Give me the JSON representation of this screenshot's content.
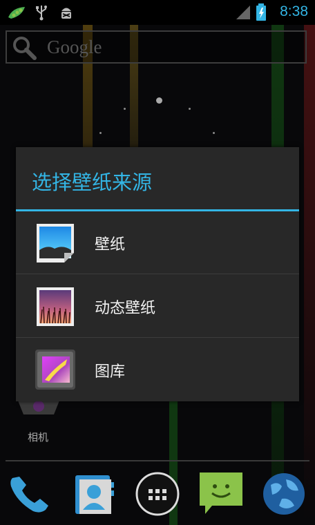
{
  "status_bar": {
    "time": "8:38",
    "icons": [
      "pea-pod-icon",
      "usb-icon",
      "android-debug-icon",
      "signal-icon",
      "battery-charging-icon"
    ]
  },
  "search_bar": {
    "text": "Google",
    "icon": "search-icon"
  },
  "dialog": {
    "title": "选择壁纸来源",
    "items": [
      {
        "label": "壁纸",
        "icon": "wallpaper-icon"
      },
      {
        "label": "动态壁纸",
        "icon": "live-wallpaper-icon"
      },
      {
        "label": "图库",
        "icon": "gallery-icon"
      }
    ]
  },
  "home": {
    "camera_label": "相机",
    "dock": [
      "phone-icon",
      "contacts-icon",
      "app-drawer-icon",
      "messaging-icon",
      "browser-icon"
    ]
  },
  "colors": {
    "accent": "#33b5e5",
    "dialog_bg": "#282828"
  }
}
